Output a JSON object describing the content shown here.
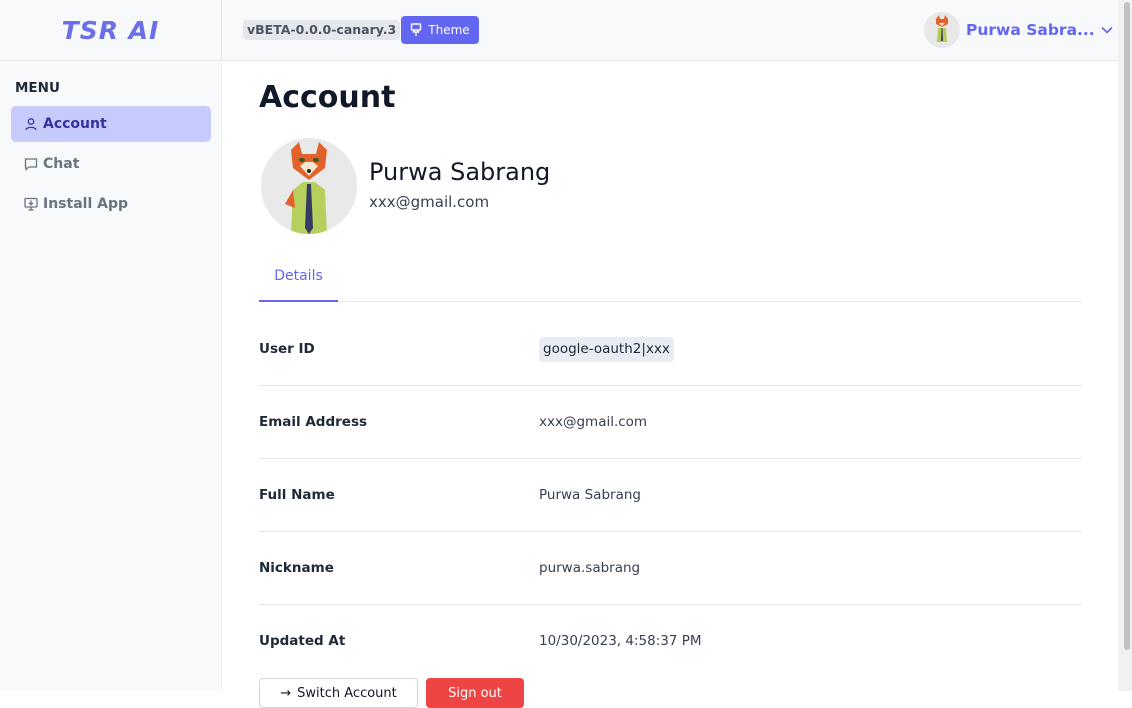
{
  "header": {
    "logo": "TSR AI",
    "version": "vBETA-0.0.0-canary.3",
    "theme_label": "Theme",
    "user_name": "Purwa Sabra..."
  },
  "sidebar": {
    "menu_title": "MENU",
    "items": [
      {
        "label": "Account",
        "icon": "user-icon",
        "active": true
      },
      {
        "label": "Chat",
        "icon": "chat-bubble-icon",
        "active": false
      },
      {
        "label": "Install App",
        "icon": "install-monitor-icon",
        "active": false
      }
    ]
  },
  "main": {
    "title": "Account",
    "profile_name": "Purwa Sabrang",
    "profile_email": "xxx@gmail.com",
    "tabs": [
      {
        "label": "Details",
        "active": true
      }
    ],
    "details": [
      {
        "label": "User ID",
        "value": "google-oauth2|xxx"
      },
      {
        "label": "Email Address",
        "value": "xxx@gmail.com"
      },
      {
        "label": "Full Name",
        "value": "Purwa Sabrang"
      },
      {
        "label": "Nickname",
        "value": "purwa.sabrang"
      },
      {
        "label": "Updated At",
        "value": "10/30/2023, 4:58:37 PM"
      }
    ],
    "buttons": {
      "secondary": "Switch Account",
      "danger": "Sign out"
    }
  },
  "colors": {
    "accent": "#6366f1",
    "active_nav_bg": "#c7cbfb",
    "danger": "#ef4444"
  }
}
